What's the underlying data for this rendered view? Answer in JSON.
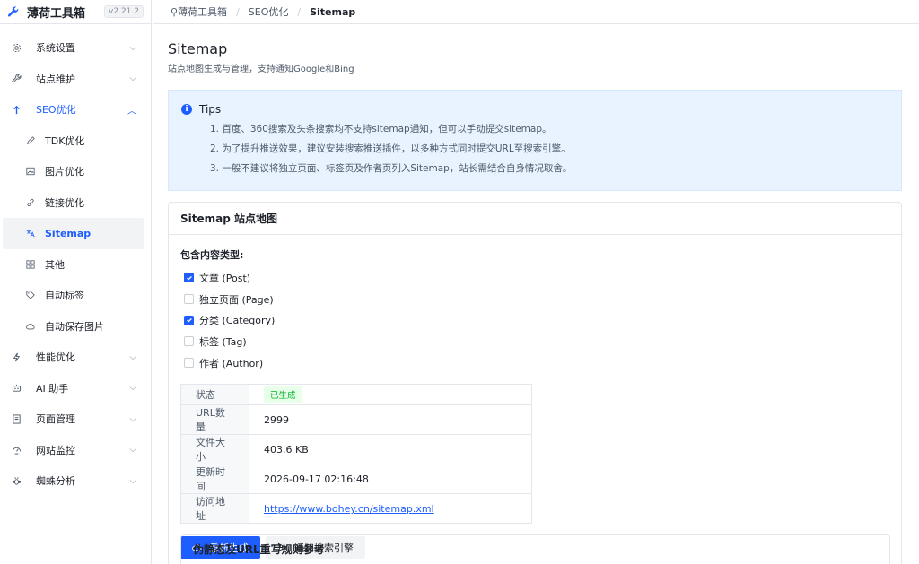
{
  "app": {
    "name": "薄荷工具箱",
    "version": "v2.21.2"
  },
  "sidebar": {
    "items": [
      {
        "label": "系统设置",
        "icon": "gear-icon"
      },
      {
        "label": "站点维护",
        "icon": "wrench-icon"
      },
      {
        "label": "SEO优化",
        "icon": "arrow-up-icon"
      },
      {
        "label": "性能优化",
        "icon": "bolt-icon"
      },
      {
        "label": "AI 助手",
        "icon": "robot-icon"
      },
      {
        "label": "页面管理",
        "icon": "page-icon"
      },
      {
        "label": "网站监控",
        "icon": "monitor-icon"
      },
      {
        "label": "蜘蛛分析",
        "icon": "spider-icon"
      }
    ],
    "seo_sub": [
      {
        "label": "TDK优化",
        "icon": "pen-icon"
      },
      {
        "label": "图片优化",
        "icon": "image-icon"
      },
      {
        "label": "链接优化",
        "icon": "link-icon"
      },
      {
        "label": "Sitemap",
        "icon": "translate-icon"
      },
      {
        "label": "其他",
        "icon": "grid-icon"
      },
      {
        "label": "自动标签",
        "icon": "tag-icon"
      },
      {
        "label": "自动保存图片",
        "icon": "cloud-icon"
      }
    ]
  },
  "breadcrumb": {
    "root": "薄荷工具箱",
    "parent": "SEO优化",
    "current": "Sitemap"
  },
  "page": {
    "title": "Sitemap",
    "subtitle": "站点地图生成与管理，支持通知Google和Bing"
  },
  "tips": {
    "title": "Tips",
    "lines": [
      "1. 百度、360搜索及头条搜索均不支持sitemap通知，但可以手动提交sitemap。",
      "2. 为了提升推送效果，建议安装搜索推送插件，以多种方式同时提交URL至搜索引擎。",
      "3. 一般不建议将独立页面、标签页及作者页列入Sitemap，站长需结合自身情况取舍。"
    ]
  },
  "sitemap_card": {
    "title": "Sitemap 站点地图",
    "content_types_label": "包含内容类型:",
    "content_types": [
      {
        "label": "文章 (Post)",
        "checked": true
      },
      {
        "label": "独立页面 (Page)",
        "checked": false
      },
      {
        "label": "分类 (Category)",
        "checked": true
      },
      {
        "label": "标签 (Tag)",
        "checked": false
      },
      {
        "label": "作者 (Author)",
        "checked": false
      }
    ],
    "info": {
      "status_label": "状态",
      "status_value": "已生成",
      "url_count_label": "URL数量",
      "url_count_value": "2999",
      "file_size_label": "文件大小",
      "file_size_value": "403.6 KB",
      "updated_label": "更新时间",
      "updated_value": "2026-09-17 02:16:48",
      "address_label": "访问地址",
      "address_value": "https://www.bohey.cn/sitemap.xml"
    },
    "regenerate_button": "重新生成",
    "notify_button": "通知搜索引擎"
  },
  "rewrite_card": {
    "title": "伪静态及URL重写规则参考"
  },
  "colors": {
    "accent": "#1e5eff",
    "success": "#00b42a",
    "tips_bg": "#e8f3ff"
  }
}
